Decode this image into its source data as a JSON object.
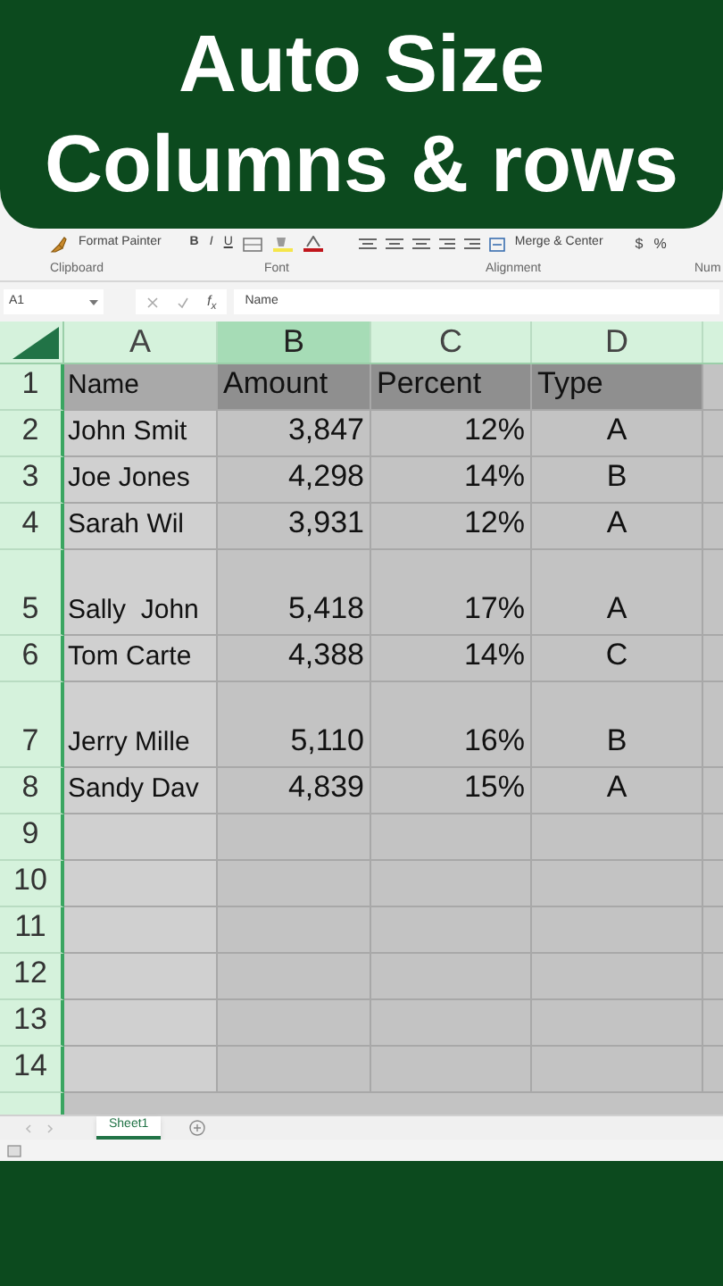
{
  "banner": {
    "title_lines": [
      "Auto Size",
      "Columns & rows"
    ]
  },
  "ribbon": {
    "clipboard_button": "Format Painter",
    "font_buttons": [
      "B",
      "I",
      "U"
    ],
    "merge_button": "Merge & Center",
    "number_buttons": [
      "$",
      "%"
    ],
    "groups": [
      "Clipboard",
      "Font",
      "Alignment",
      "Num"
    ]
  },
  "formula_bar": {
    "name_box": "A1",
    "function_label": "f$_{x}$",
    "value": "Name"
  },
  "columns": [
    {
      "label": "A",
      "selected": false
    },
    {
      "label": "B",
      "selected": true
    },
    {
      "label": "C",
      "selected": false
    },
    {
      "label": "D",
      "selected": false
    }
  ],
  "rows": [
    {
      "number": "1",
      "kind": "header",
      "cells": [
        "Name",
        "Amount",
        "Percent",
        "Type"
      ]
    },
    {
      "number": "2",
      "kind": "normal",
      "cells": [
        "John Smit",
        "3,847",
        "12%",
        "A"
      ]
    },
    {
      "number": "3",
      "kind": "normal",
      "cells": [
        "Joe Jones",
        "4,298",
        "14%",
        "B"
      ]
    },
    {
      "number": "4",
      "kind": "normal",
      "cells": [
        "Sarah Wil",
        "3,931",
        "12%",
        "A"
      ]
    },
    {
      "number": "5",
      "kind": "tall",
      "cells": [
        "Sally  John",
        "5,418",
        "17%",
        "A"
      ]
    },
    {
      "number": "6",
      "kind": "normal",
      "cells": [
        "Tom Carte",
        "4,388",
        "14%",
        "C"
      ]
    },
    {
      "number": "7",
      "kind": "tall",
      "cells": [
        "Jerry Mille",
        "5,110",
        "16%",
        "B"
      ]
    },
    {
      "number": "8",
      "kind": "normal",
      "cells": [
        "Sandy Dav",
        "4,839",
        "15%",
        "A"
      ]
    },
    {
      "number": "9",
      "kind": "normal"
    },
    {
      "number": "10",
      "kind": "normal"
    },
    {
      "number": "11",
      "kind": "normal"
    },
    {
      "number": "12",
      "kind": "normal"
    },
    {
      "number": "13",
      "kind": "normal"
    },
    {
      "number": "14",
      "kind": "normal"
    }
  ],
  "sheet_tabs": [
    {
      "label": "Sheet1",
      "selected": true
    }
  ]
}
